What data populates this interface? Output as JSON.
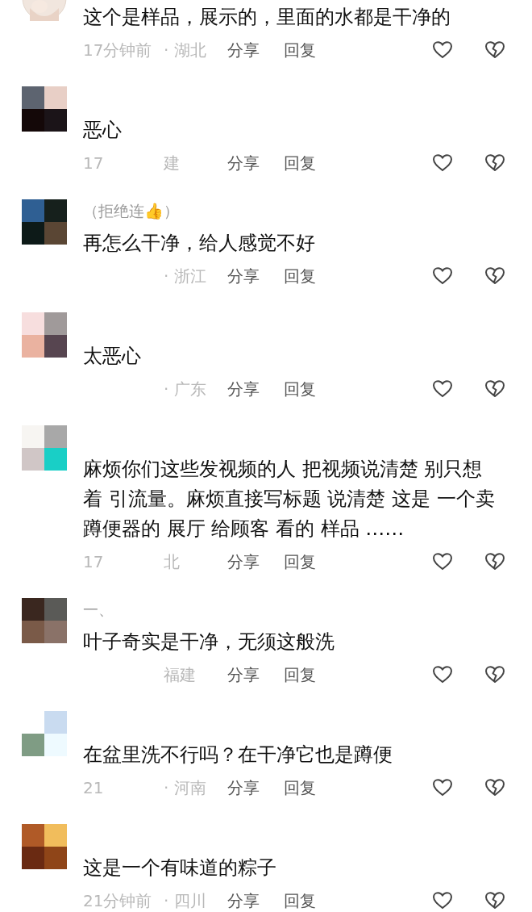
{
  "comments": [
    {
      "lines": [
        "这个是样品，展示的，里面的水都是干净的"
      ],
      "time": "17分钟前",
      "region": "· 湖北",
      "share": "分享",
      "reply": "回复"
    },
    {
      "lines": [
        "恶心"
      ],
      "time": "17",
      "region": "建",
      "share": "分享",
      "reply": "回复"
    },
    {
      "author": "（拒绝连👍）",
      "lines": [
        "再怎么干净，给人感觉不好"
      ],
      "region": "· 浙江",
      "share": "分享",
      "reply": "回复"
    },
    {
      "lines": [
        "太恶心"
      ],
      "region": "· 广东",
      "share": "分享",
      "reply": "回复"
    },
    {
      "lines": [
        "麻烦你们这些发视频的人 把视频说清楚 别只想",
        "着 引流量。麻烦直接写标题 说清楚 这是 一个卖",
        "蹲便器的 展厅 给顾客 看的 样品 ……"
      ],
      "time": "17",
      "region": "北",
      "share": "分享",
      "reply": "回复"
    },
    {
      "author": "一、",
      "lines": [
        "叶子奇实是干净，无须这般洗"
      ],
      "region": "福建",
      "share": "分享",
      "reply": "回复"
    },
    {
      "lines": [
        "在盆里洗不行吗？在干净它也是蹲便"
      ],
      "time": "21",
      "region": "· 河南",
      "share": "分享",
      "reply": "回复"
    },
    {
      "lines": [
        "这是一个有味道的粽子"
      ],
      "time": "21分钟前",
      "region": "· 四川",
      "share": "分享",
      "reply": "回复"
    }
  ]
}
